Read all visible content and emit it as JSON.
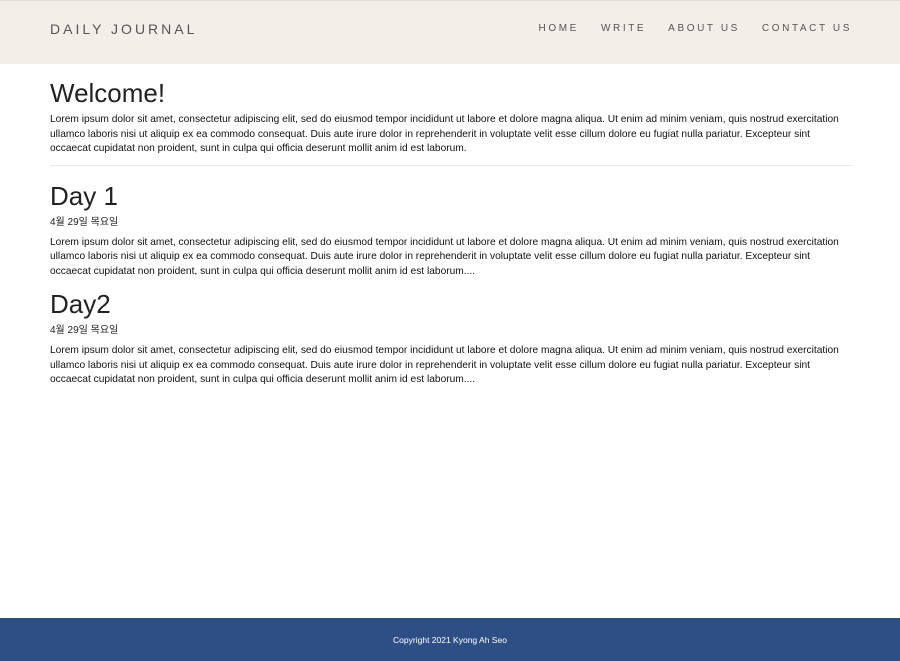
{
  "header": {
    "brand": "DAILY JOURNAL",
    "nav": [
      {
        "label": "HOME"
      },
      {
        "label": "WRITE"
      },
      {
        "label": "ABOUT US"
      },
      {
        "label": "CONTACT US"
      }
    ]
  },
  "welcome": {
    "title": "Welcome!",
    "text": "Lorem ipsum dolor sit amet, consectetur adipiscing elit, sed do eiusmod tempor incididunt ut labore et dolore magna aliqua. Ut enim ad minim veniam, quis nostrud exercitation ullamco laboris nisi ut aliquip ex ea commodo consequat. Duis aute irure dolor in reprehenderit in voluptate velit esse cillum dolore eu fugiat nulla pariatur. Excepteur sint occaecat cupidatat non proident, sunt in culpa qui officia deserunt mollit anim id est laborum."
  },
  "posts": [
    {
      "title": "Day 1",
      "date": "4월 29일 목요일",
      "text": "Lorem ipsum dolor sit amet, consectetur adipiscing elit, sed do eiusmod tempor incididunt ut labore et dolore magna aliqua. Ut enim ad minim veniam, quis nostrud exercitation ullamco laboris nisi ut aliquip ex ea commodo consequat. Duis aute irure dolor in reprehenderit in voluptate velit esse cillum dolore eu fugiat nulla pariatur. Excepteur sint occaecat cupidatat non proident, sunt in culpa qui officia deserunt mollit anim id est laborum...."
    },
    {
      "title": "Day2",
      "date": "4월 29일 목요일",
      "text": "Lorem ipsum dolor sit amet, consectetur adipiscing elit, sed do eiusmod tempor incididunt ut labore et dolore magna aliqua. Ut enim ad minim veniam, quis nostrud exercitation ullamco laboris nisi ut aliquip ex ea commodo consequat. Duis aute irure dolor in reprehenderit in voluptate velit esse cillum dolore eu fugiat nulla pariatur. Excepteur sint occaecat cupidatat non proident, sunt in culpa qui officia deserunt mollit anim id est laborum...."
    }
  ],
  "footer": {
    "text": "Copyright 2021 Kyong Ah Seo"
  },
  "colors": {
    "navbar_bg": "#f3eee8",
    "footer_bg": "#2e4f85"
  }
}
